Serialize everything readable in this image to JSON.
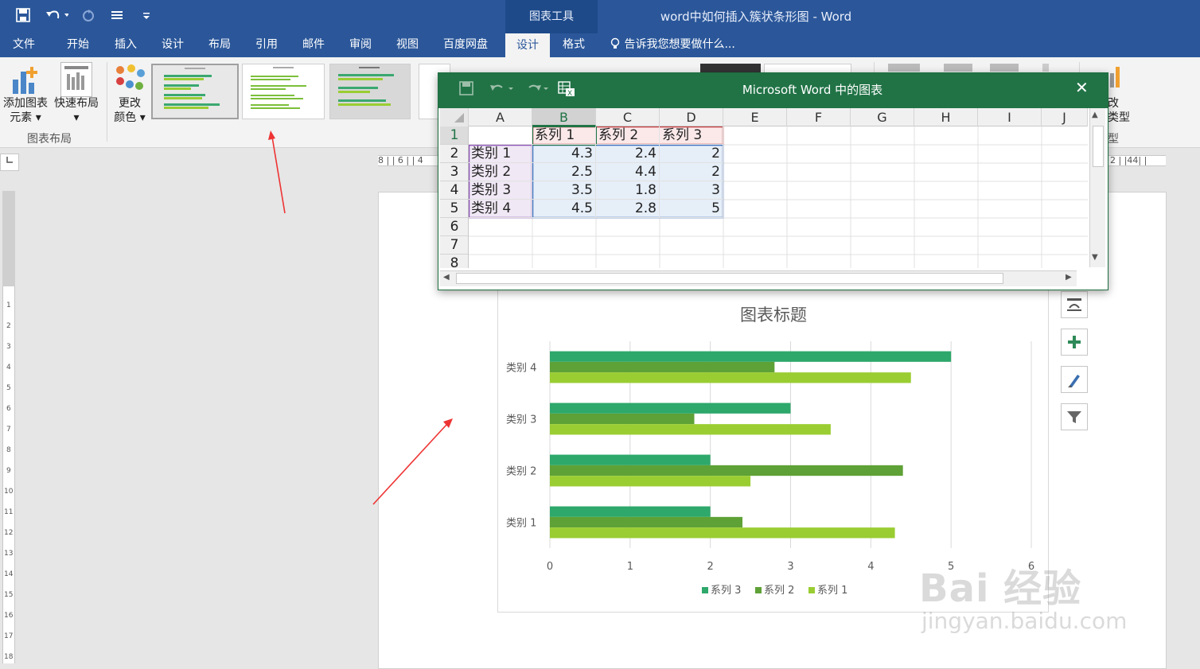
{
  "titlebar": {
    "context_tools": "图表工具",
    "document_title": "word中如何插入簇状条形图 - Word"
  },
  "tabs": [
    "文件",
    "开始",
    "插入",
    "设计",
    "布局",
    "引用",
    "邮件",
    "审阅",
    "视图",
    "百度网盘",
    "设计",
    "格式"
  ],
  "active_tab_index": 10,
  "tell_me": "告诉我您想要做什么...",
  "ribbon": {
    "add_element": [
      "添加图表",
      "元素"
    ],
    "quick_layout": "快速布局",
    "change_colors": [
      "更改",
      "颜色"
    ],
    "group_chart_layouts": "图表布局",
    "change_type_right": [
      "改",
      "类型",
      "型"
    ]
  },
  "hruler_labels": "8 | | 6 | | 4",
  "hruler_right": "2 | |44| |",
  "excel": {
    "title": "Microsoft Word 中的图表",
    "columns": [
      "A",
      "B",
      "C",
      "D",
      "E",
      "F",
      "G",
      "H",
      "I",
      "J"
    ],
    "rows": [
      "1",
      "2",
      "3",
      "4",
      "5",
      "6",
      "7",
      "8"
    ],
    "header_row": [
      "",
      "系列 1",
      "系列 2",
      "系列 3"
    ],
    "data_rows": [
      [
        "类别 1",
        "4.3",
        "2.4",
        "2"
      ],
      [
        "类别 2",
        "2.5",
        "4.4",
        "2"
      ],
      [
        "类别 3",
        "3.5",
        "1.8",
        "3"
      ],
      [
        "类别 4",
        "4.5",
        "2.8",
        "5"
      ]
    ]
  },
  "chart_data": {
    "type": "bar",
    "orientation": "horizontal",
    "title": "图表标题",
    "categories": [
      "类别 1",
      "类别 2",
      "类别 3",
      "类别 4"
    ],
    "series": [
      {
        "name": "系列 1",
        "values": [
          4.3,
          2.5,
          3.5,
          4.5
        ],
        "color": "#9acd32"
      },
      {
        "name": "系列 2",
        "values": [
          2.4,
          4.4,
          1.8,
          2.8
        ],
        "color": "#5ea136"
      },
      {
        "name": "系列 3",
        "values": [
          2,
          2,
          3,
          5
        ],
        "color": "#2ea86b"
      }
    ],
    "xlim": [
      0,
      6
    ],
    "xticks": [
      "0",
      "1",
      "2",
      "3",
      "4",
      "5",
      "6"
    ],
    "legend": [
      "系列 3",
      "系列 2",
      "系列 1"
    ],
    "legend_position": "bottom",
    "grid": true
  },
  "watermark": {
    "brand": "Bai 经验",
    "url": "jingyan.baidu.com"
  }
}
